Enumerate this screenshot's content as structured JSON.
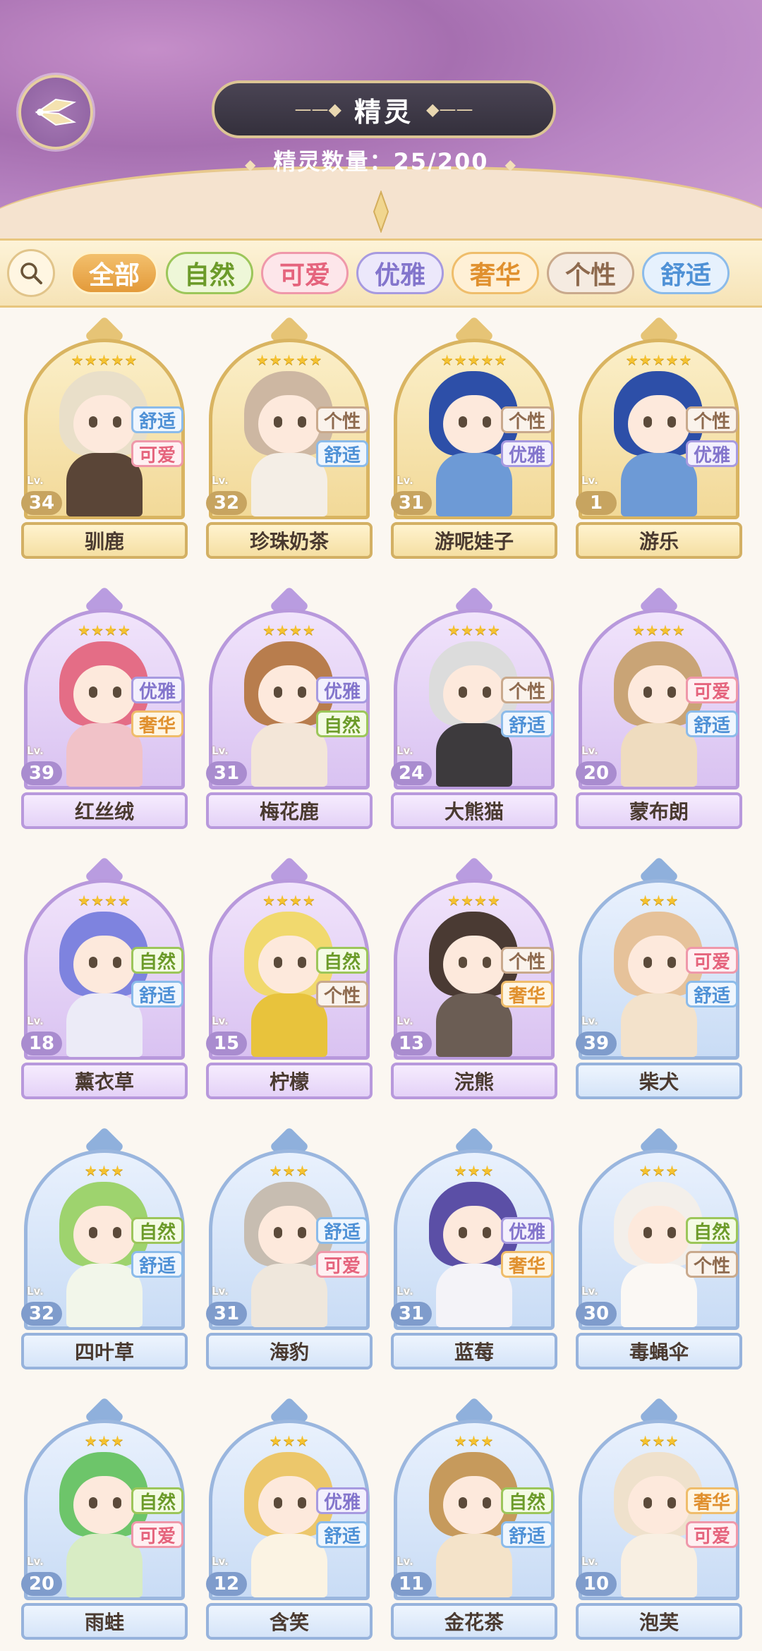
{
  "header": {
    "title": "精灵",
    "count_label": "精灵数量：25/200"
  },
  "filters": [
    "全部",
    "自然",
    "可爱",
    "优雅",
    "奢华",
    "个性",
    "舒适"
  ],
  "level_prefix": "Lv.",
  "spirits": [
    {
      "name": "驯鹿",
      "level": "34",
      "stars": "★★★★★",
      "tags": [
        "舒适",
        "可爱"
      ],
      "hair": "#e9dfc9",
      "body": "#5a4537"
    },
    {
      "name": "珍珠奶茶",
      "level": "32",
      "stars": "★★★★★",
      "tags": [
        "个性",
        "舒适"
      ],
      "hair": "#cdb7a2",
      "body": "#f4eee6"
    },
    {
      "name": "游呢娃子",
      "level": "31",
      "stars": "★★★★★",
      "tags": [
        "个性",
        "优雅"
      ],
      "hair": "#2d4fa8",
      "body": "#6d9ad6"
    },
    {
      "name": "游乐",
      "level": "1",
      "stars": "★★★★★",
      "tags": [
        "个性",
        "优雅"
      ],
      "hair": "#2d4fa8",
      "body": "#6d9ad6"
    },
    {
      "name": "红丝绒",
      "level": "39",
      "stars": "★★★★",
      "tags": [
        "优雅",
        "奢华"
      ],
      "hair": "#e46d86",
      "body": "#f1c2c8"
    },
    {
      "name": "梅花鹿",
      "level": "31",
      "stars": "★★★★",
      "tags": [
        "优雅",
        "自然"
      ],
      "hair": "#b87d4d",
      "body": "#f3e6d8"
    },
    {
      "name": "大熊猫",
      "level": "24",
      "stars": "★★★★",
      "tags": [
        "个性",
        "舒适"
      ],
      "hair": "#dcdcdc",
      "body": "#3d3a3d"
    },
    {
      "name": "蒙布朗",
      "level": "20",
      "stars": "★★★★",
      "tags": [
        "可爱",
        "舒适"
      ],
      "hair": "#c9a476",
      "body": "#efdcbf"
    },
    {
      "name": "薰衣草",
      "level": "18",
      "stars": "★★★★",
      "tags": [
        "自然",
        "舒适"
      ],
      "hair": "#7e83df",
      "body": "#ecebf7"
    },
    {
      "name": "柠檬",
      "level": "15",
      "stars": "★★★★",
      "tags": [
        "自然",
        "个性"
      ],
      "hair": "#f1d96e",
      "body": "#e8c33c"
    },
    {
      "name": "浣熊",
      "level": "13",
      "stars": "★★★★",
      "tags": [
        "个性",
        "奢华"
      ],
      "hair": "#4a3a33",
      "body": "#6b5d54"
    },
    {
      "name": "柴犬",
      "level": "39",
      "stars": "★★★",
      "tags": [
        "可爱",
        "舒适"
      ],
      "hair": "#e6c29a",
      "body": "#f3e2cb"
    },
    {
      "name": "四叶草",
      "level": "32",
      "stars": "★★★",
      "tags": [
        "自然",
        "舒适"
      ],
      "hair": "#9ed36e",
      "body": "#f2f6ea"
    },
    {
      "name": "海豹",
      "level": "31",
      "stars": "★★★",
      "tags": [
        "舒适",
        "可爱"
      ],
      "hair": "#c7bdb1",
      "body": "#efe7dc"
    },
    {
      "name": "蓝莓",
      "level": "31",
      "stars": "★★★",
      "tags": [
        "优雅",
        "奢华"
      ],
      "hair": "#5b4fa6",
      "body": "#f4f3f8"
    },
    {
      "name": "毒蝇伞",
      "level": "30",
      "stars": "★★★",
      "tags": [
        "自然",
        "个性"
      ],
      "hair": "#f3efea",
      "body": "#fbf8f4"
    },
    {
      "name": "雨蛙",
      "level": "20",
      "stars": "★★★",
      "tags": [
        "自然",
        "可爱"
      ],
      "hair": "#6dc56a",
      "body": "#d8ecc4"
    },
    {
      "name": "含笑",
      "level": "12",
      "stars": "★★★",
      "tags": [
        "优雅",
        "舒适"
      ],
      "hair": "#ecc76b",
      "body": "#fbf3e3"
    },
    {
      "name": "金花茶",
      "level": "11",
      "stars": "★★★",
      "tags": [
        "自然",
        "舒适"
      ],
      "hair": "#c69a5c",
      "body": "#f4e3c9"
    },
    {
      "name": "泡芙",
      "level": "10",
      "stars": "★★★",
      "tags": [
        "奢华",
        "可爱"
      ],
      "hair": "#efe1cc",
      "body": "#f8efe2"
    }
  ]
}
